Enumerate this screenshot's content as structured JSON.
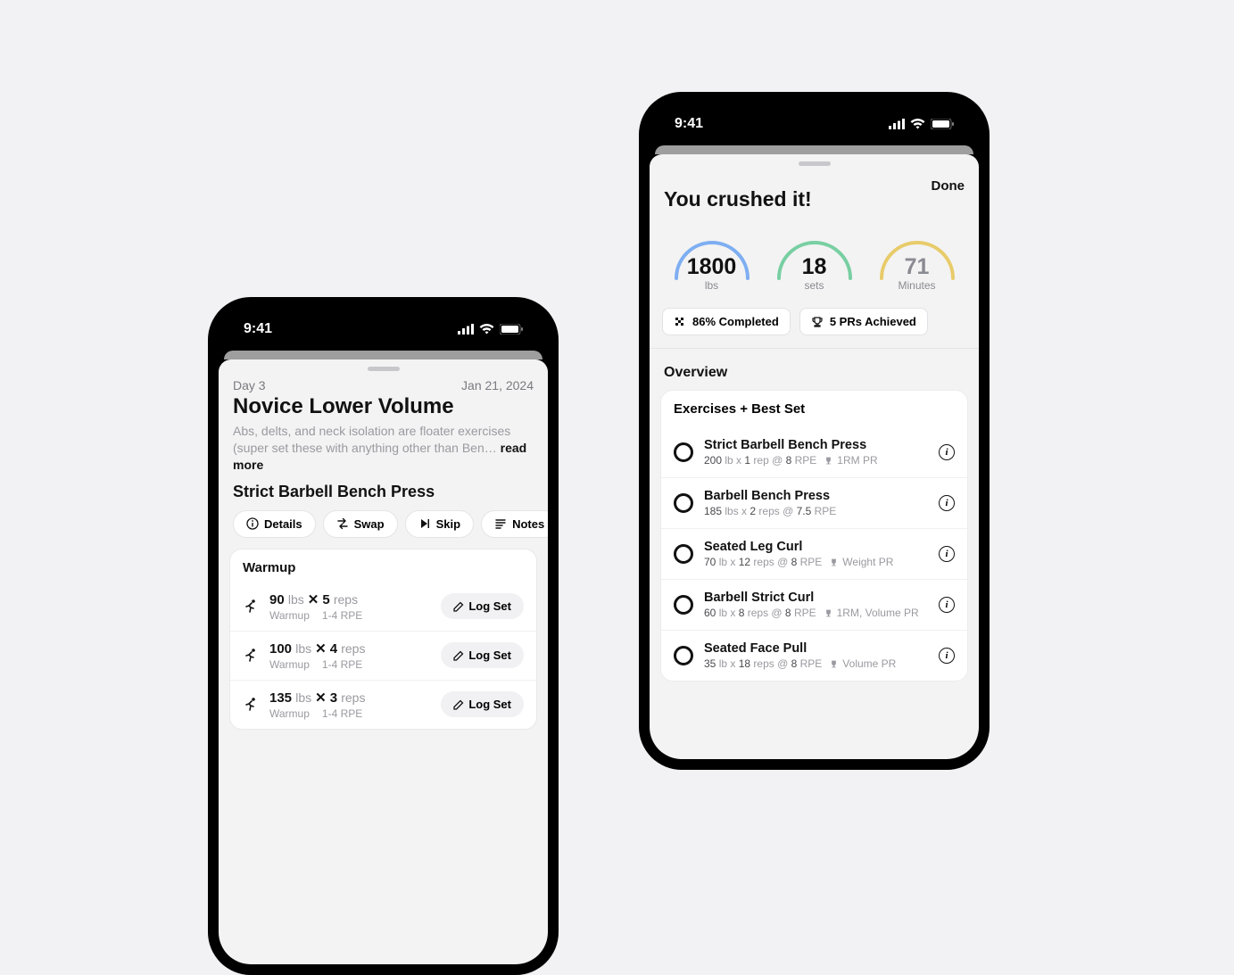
{
  "status_time": "9:41",
  "phone1": {
    "day": "Day 3",
    "date": "Jan 21, 2024",
    "title": "Novice Lower Volume",
    "desc": "Abs, delts,  and neck isolation are floater exercises (super set these with anything other than Ben… ",
    "readmore": "read more",
    "exercise_title": "Strict Barbell Bench Press",
    "actions": {
      "details": "Details",
      "swap": "Swap",
      "skip": "Skip",
      "notes": "Notes"
    },
    "warmup_header": "Warmup",
    "log_set": "Log Set",
    "sets": [
      {
        "weight": "90",
        "unit": "lbs",
        "reps": "5",
        "reps_unit": "reps",
        "type": "Warmup",
        "rpe": "1-4 RPE"
      },
      {
        "weight": "100",
        "unit": "lbs",
        "reps": "4",
        "reps_unit": "reps",
        "type": "Warmup",
        "rpe": "1-4 RPE"
      },
      {
        "weight": "135",
        "unit": "lbs",
        "reps": "3",
        "reps_unit": "reps",
        "type": "Warmup",
        "rpe": "1-4 RPE"
      }
    ]
  },
  "phone2": {
    "done": "Done",
    "title": "You crushed it!",
    "gauges": [
      {
        "value": "1800",
        "label": "lbs",
        "color": "#7eaef2"
      },
      {
        "value": "18",
        "label": "sets",
        "color": "#78cfa2"
      },
      {
        "value": "71",
        "label": "Minutes",
        "color": "#e8cb6a"
      }
    ],
    "badges": [
      {
        "text": "86% Completed"
      },
      {
        "text": "5 PRs Achieved"
      }
    ],
    "overview": "Overview",
    "ex_header": "Exercises + Best Set",
    "exercises": [
      {
        "name": "Strict Barbell Bench Press",
        "w": "200",
        "wu": "lb",
        "r": "1",
        "ru": "rep",
        "rpe": "8",
        "pr": "1RM PR"
      },
      {
        "name": "Barbell Bench Press",
        "w": "185",
        "wu": "lbs",
        "r": "2",
        "ru": "reps",
        "rpe": "7.5",
        "pr": ""
      },
      {
        "name": "Seated Leg Curl",
        "w": "70",
        "wu": "lb",
        "r": "12",
        "ru": "reps",
        "rpe": "8",
        "pr": "Weight PR"
      },
      {
        "name": "Barbell Strict Curl",
        "w": "60",
        "wu": "lb",
        "r": "8",
        "ru": "reps",
        "rpe": "8",
        "pr": "1RM, Volume PR"
      },
      {
        "name": "Seated Face Pull",
        "w": "35",
        "wu": "lb",
        "r": "18",
        "ru": "reps",
        "rpe": "8",
        "pr": "Volume PR"
      }
    ]
  }
}
